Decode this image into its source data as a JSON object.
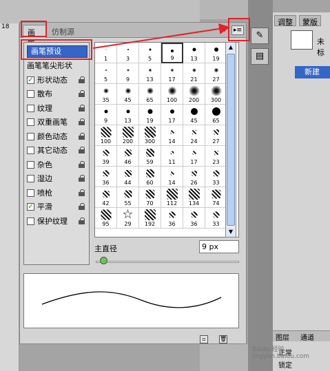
{
  "canvas": {
    "ruler_number": "18"
  },
  "brush_panel": {
    "tabs": [
      "画笔",
      "仿制源"
    ],
    "collapse_glyph": "◂◂",
    "menu_icon": "panel-menu-icon",
    "preset_button": "画笔预设",
    "options": [
      {
        "label": "画笔笔尖形状",
        "checkbox": false,
        "checked": false,
        "lock": false
      },
      {
        "label": "形状动态",
        "checkbox": true,
        "checked": true,
        "lock": true
      },
      {
        "label": "散布",
        "checkbox": true,
        "checked": false,
        "lock": true
      },
      {
        "label": "纹理",
        "checkbox": true,
        "checked": false,
        "lock": true
      },
      {
        "label": "双重画笔",
        "checkbox": true,
        "checked": false,
        "lock": true
      },
      {
        "label": "颜色动态",
        "checkbox": true,
        "checked": false,
        "lock": true
      },
      {
        "label": "其它动态",
        "checkbox": true,
        "checked": false,
        "lock": true
      },
      {
        "label": "杂色",
        "checkbox": true,
        "checked": false,
        "lock": true
      },
      {
        "label": "湿边",
        "checkbox": true,
        "checked": false,
        "lock": true
      },
      {
        "label": "喷枪",
        "checkbox": true,
        "checked": false,
        "lock": true
      },
      {
        "label": "平滑",
        "checkbox": true,
        "checked": true,
        "lock": true
      },
      {
        "label": "保护纹理",
        "checkbox": true,
        "checked": false,
        "lock": true
      }
    ],
    "brush_sizes": [
      "1",
      "3",
      "5",
      "9",
      "13",
      "19",
      "5",
      "9",
      "13",
      "17",
      "21",
      "27",
      "35",
      "45",
      "65",
      "100",
      "200",
      "300",
      "9",
      "13",
      "19",
      "17",
      "45",
      "65",
      "100",
      "200",
      "300",
      "14",
      "24",
      "27",
      "39",
      "46",
      "59",
      "11",
      "17",
      "23",
      "36",
      "44",
      "60",
      "14",
      "26",
      "33",
      "42",
      "55",
      "70",
      "112",
      "134",
      "74",
      "95",
      "29",
      "192",
      "36",
      "36",
      "33"
    ],
    "selected_brush": "9",
    "master_diameter_label": "主直径",
    "master_diameter_value": "9 px",
    "slider_value": 0.03,
    "bottom_icons": [
      "new-preset-icon",
      "trash-icon"
    ]
  },
  "right_dock": {
    "tabs": [
      "调整",
      "蒙版"
    ],
    "document_name": "未标",
    "new_label": "新建",
    "layer_tabs": [
      "图层",
      "通道"
    ],
    "blend_mode": "正常",
    "lock_label": "锁定"
  },
  "watermark": "Baidu 经验 jingyan.baidu.com",
  "colors": {
    "highlight_red": "#e0232a",
    "selection_blue": "#3565c7",
    "check_green": "#1a8a1a"
  }
}
